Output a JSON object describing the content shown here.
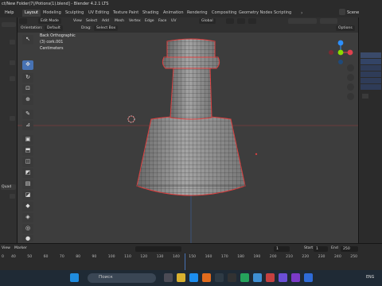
{
  "window": {
    "title": "ct/New Folder(7)/Potions(1).blend] - Blender 4.2.1 LTS",
    "left_menu": "Help"
  },
  "workspaces": [
    "Layout",
    "Modeling",
    "Sculpting",
    "UV Editing",
    "Texture Paint",
    "Shading",
    "Animation",
    "Rendering",
    "Compositing",
    "Geometry Nodes",
    "Scripting"
  ],
  "workspace_active": "Layout",
  "scene_label": "Scene",
  "viewport_header": {
    "mode": "Edit Mode",
    "menus": [
      "View",
      "Select",
      "Add",
      "Mesh",
      "Vertex",
      "Edge",
      "Face",
      "UV"
    ],
    "transform": "Global",
    "options": "Options"
  },
  "tool_settings": {
    "orientation_label": "Orientation:",
    "orientation_value": "Default",
    "drag_label": "Drag:",
    "drag_value": "Select Box"
  },
  "viewport_overlay": {
    "view_name": "Back Orthographic",
    "object_name": "(3) cork.001",
    "units": "Centimeters"
  },
  "gizmo": {
    "colors": {
      "x": "#e0414f",
      "y": "#8bdc00",
      "z": "#2c8fff"
    }
  },
  "left_panel": {
    "field_label": "Quad"
  },
  "timeline": {
    "menus": [
      "View",
      "Marker"
    ],
    "current_frame": "1",
    "start_label": "Start",
    "start_value": "1",
    "end_label": "End",
    "end_value": "250",
    "ruler": [
      "40",
      "50",
      "60",
      "70",
      "80",
      "90",
      "100",
      "110",
      "120",
      "130",
      "140",
      "150",
      "160",
      "170",
      "180",
      "190",
      "200",
      "210",
      "220",
      "230",
      "240",
      "250"
    ],
    "ruler_left": "0"
  },
  "taskbar": {
    "search_placeholder": "Поиск",
    "lang": "ENG"
  },
  "colors": {
    "accent": "#4772b3",
    "selected_edge": "#e04040",
    "wire": "#1a1a1a",
    "mesh_face": "#8a8a8a"
  }
}
